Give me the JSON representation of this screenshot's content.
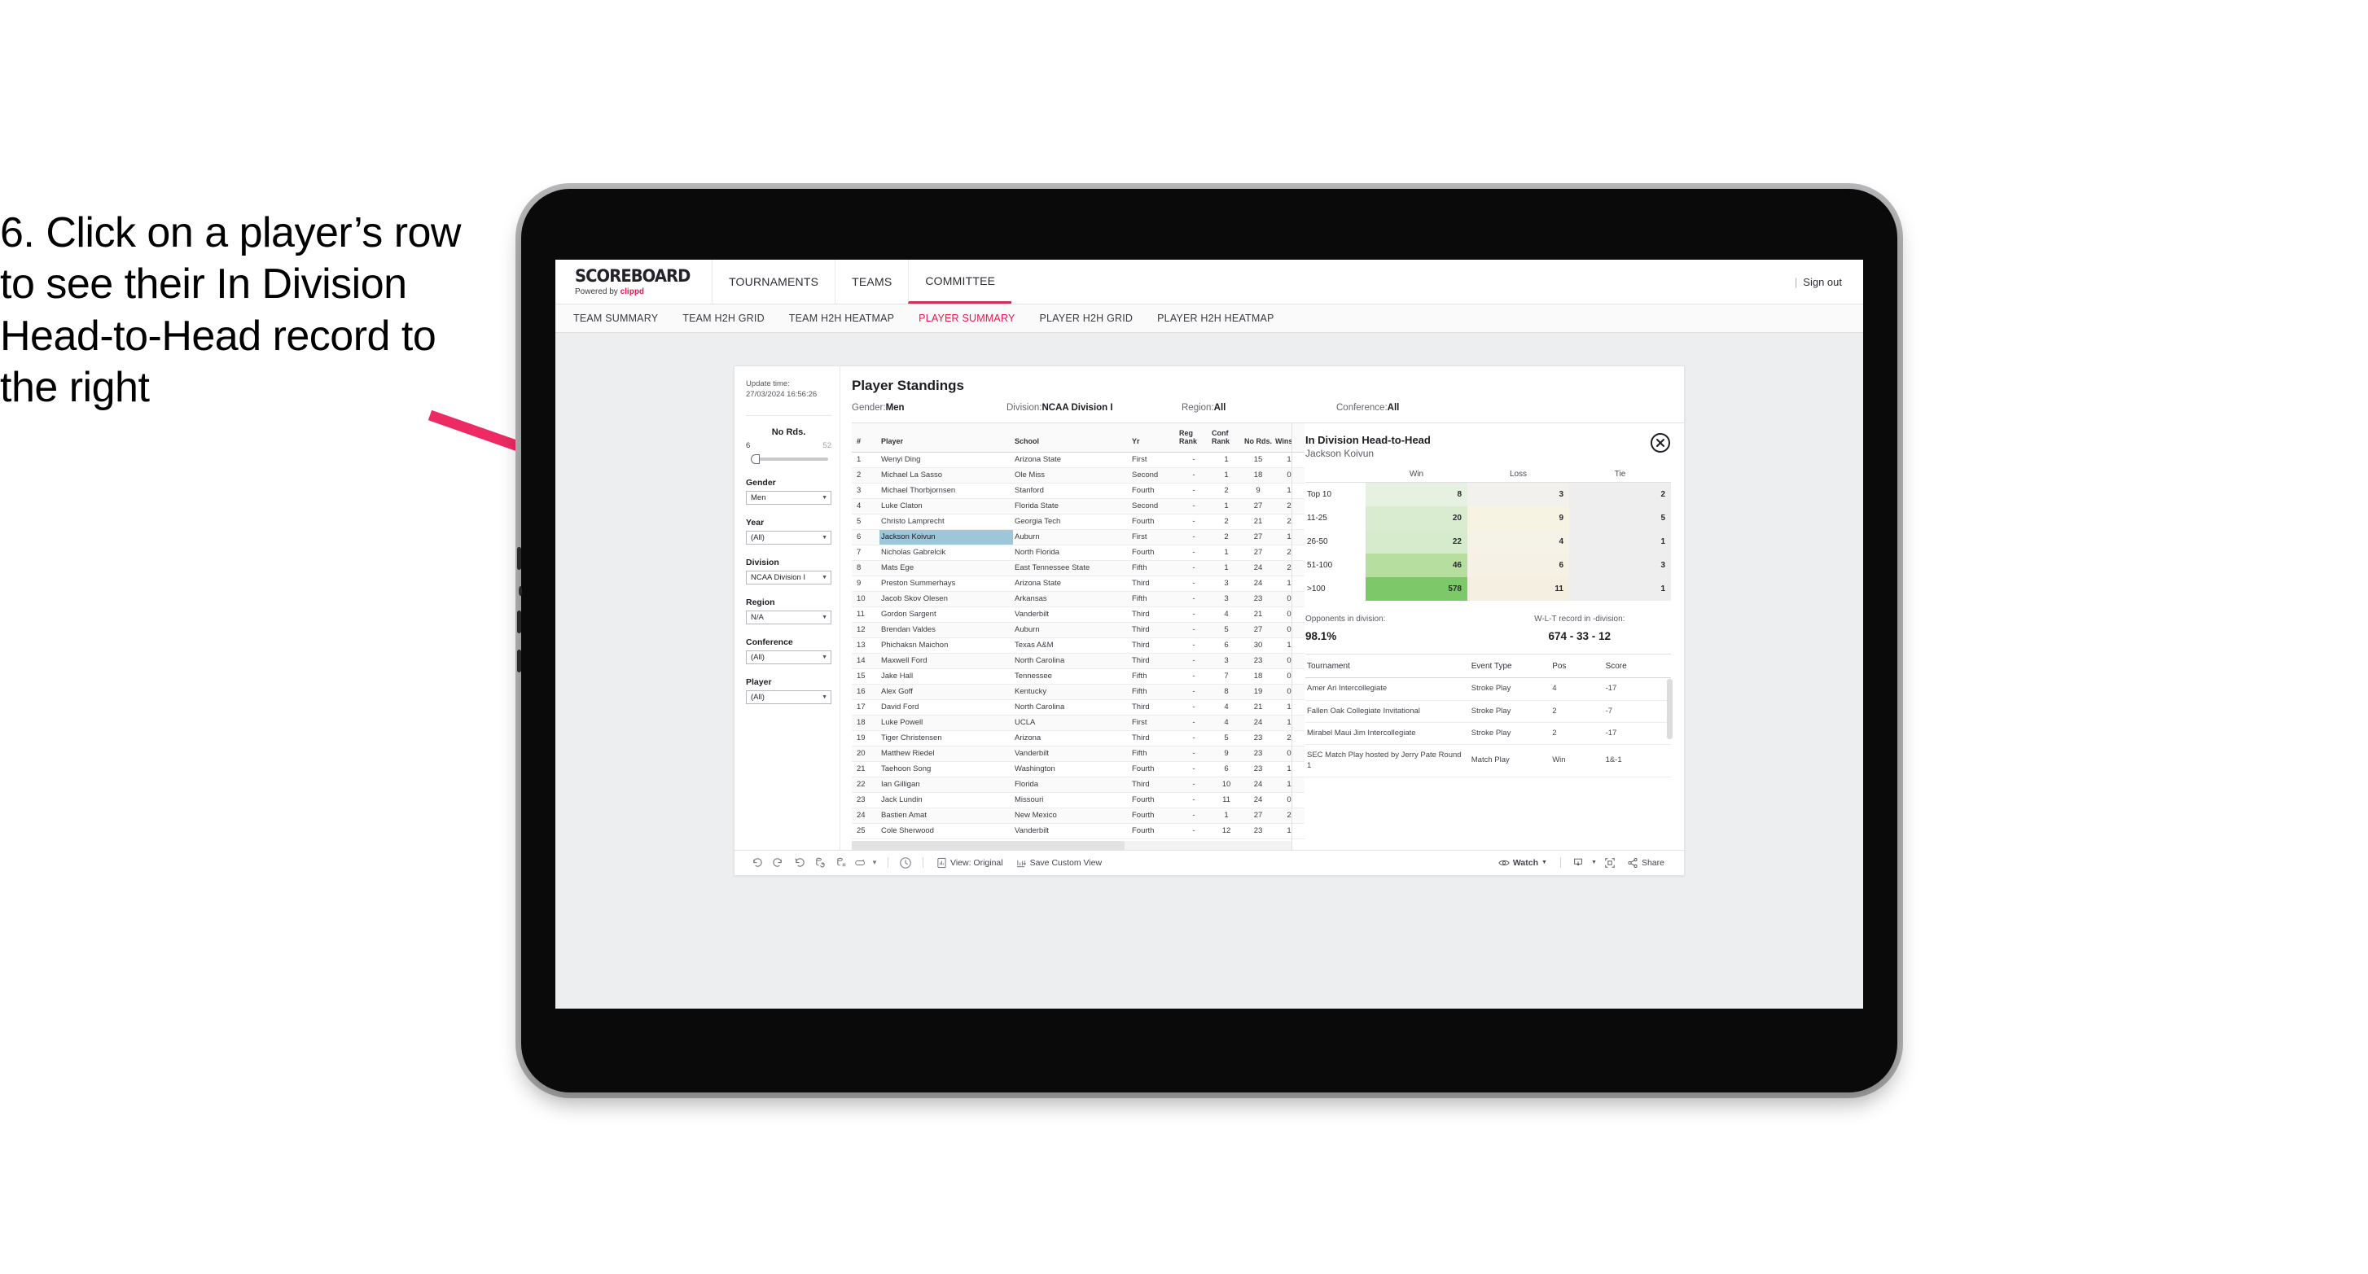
{
  "instruction": "6. Click on a player’s row to see their In Division Head-to-Head record to the right",
  "arrow": {
    "color": "#ed2a63"
  },
  "header": {
    "brand_title": "SCOREBOARD",
    "brand_prefix": "Powered by ",
    "brand_name": "clippd",
    "nav": [
      {
        "label": "TOURNAMENTS",
        "active": false
      },
      {
        "label": "TEAMS",
        "active": false
      },
      {
        "label": "COMMITTEE",
        "active": true
      }
    ],
    "user_separator": "|",
    "sign_out": "Sign out"
  },
  "subnav": [
    {
      "label": "TEAM SUMMARY",
      "active": false
    },
    {
      "label": "TEAM H2H GRID",
      "active": false
    },
    {
      "label": "TEAM H2H HEATMAP",
      "active": false
    },
    {
      "label": "PLAYER SUMMARY",
      "active": true
    },
    {
      "label": "PLAYER H2H GRID",
      "active": false
    },
    {
      "label": "PLAYER H2H HEATMAP",
      "active": false
    }
  ],
  "sidebar": {
    "update_label": "Update time:",
    "update_value": "27/03/2024 16:56:26",
    "slider": {
      "title": "No Rds.",
      "min": "6",
      "max": "52"
    },
    "filters": [
      {
        "label": "Gender",
        "value": "Men"
      },
      {
        "label": "Year",
        "value": "(All)"
      },
      {
        "label": "Division",
        "value": "NCAA Division I"
      },
      {
        "label": "Region",
        "value": "N/A"
      },
      {
        "label": "Conference",
        "value": "(All)"
      },
      {
        "label": "Player",
        "value": "(All)"
      }
    ]
  },
  "standings": {
    "title": "Player Standings",
    "meta": [
      {
        "label": "Gender: ",
        "value": "Men"
      },
      {
        "label": "Division: ",
        "value": "NCAA Division I"
      },
      {
        "label": "Region: ",
        "value": "All"
      },
      {
        "label": "Conference: ",
        "value": "All"
      }
    ],
    "columns": [
      "#",
      "Player",
      "School",
      "Yr",
      "Reg Rank",
      "Conf Rank",
      "No Rds.",
      "Wins"
    ],
    "rows": [
      [
        "1",
        "Wenyi Ding",
        "Arizona State",
        "First",
        "-",
        "1",
        "15",
        "1"
      ],
      [
        "2",
        "Michael La Sasso",
        "Ole Miss",
        "Second",
        "-",
        "1",
        "18",
        "0"
      ],
      [
        "3",
        "Michael Thorbjornsen",
        "Stanford",
        "Fourth",
        "-",
        "2",
        "9",
        "1"
      ],
      [
        "4",
        "Luke Claton",
        "Florida State",
        "Second",
        "-",
        "1",
        "27",
        "2"
      ],
      [
        "5",
        "Christo Lamprecht",
        "Georgia Tech",
        "Fourth",
        "-",
        "2",
        "21",
        "2"
      ],
      [
        "6",
        "Jackson Koivun",
        "Auburn",
        "First",
        "-",
        "2",
        "27",
        "1"
      ],
      [
        "7",
        "Nicholas Gabrelcik",
        "North Florida",
        "Fourth",
        "-",
        "1",
        "27",
        "2"
      ],
      [
        "8",
        "Mats Ege",
        "East Tennessee State",
        "Fifth",
        "-",
        "1",
        "24",
        "2"
      ],
      [
        "9",
        "Preston Summerhays",
        "Arizona State",
        "Third",
        "-",
        "3",
        "24",
        "1"
      ],
      [
        "10",
        "Jacob Skov Olesen",
        "Arkansas",
        "Fifth",
        "-",
        "3",
        "23",
        "0"
      ],
      [
        "11",
        "Gordon Sargent",
        "Vanderbilt",
        "Third",
        "-",
        "4",
        "21",
        "0"
      ],
      [
        "12",
        "Brendan Valdes",
        "Auburn",
        "Third",
        "-",
        "5",
        "27",
        "0"
      ],
      [
        "13",
        "Phichaksn Maichon",
        "Texas A&M",
        "Third",
        "-",
        "6",
        "30",
        "1"
      ],
      [
        "14",
        "Maxwell Ford",
        "North Carolina",
        "Third",
        "-",
        "3",
        "23",
        "0"
      ],
      [
        "15",
        "Jake Hall",
        "Tennessee",
        "Fifth",
        "-",
        "7",
        "18",
        "0"
      ],
      [
        "16",
        "Alex Goff",
        "Kentucky",
        "Fifth",
        "-",
        "8",
        "19",
        "0"
      ],
      [
        "17",
        "David Ford",
        "North Carolina",
        "Third",
        "-",
        "4",
        "21",
        "1"
      ],
      [
        "18",
        "Luke Powell",
        "UCLA",
        "First",
        "-",
        "4",
        "24",
        "1"
      ],
      [
        "19",
        "Tiger Christensen",
        "Arizona",
        "Third",
        "-",
        "5",
        "23",
        "2"
      ],
      [
        "20",
        "Matthew Riedel",
        "Vanderbilt",
        "Fifth",
        "-",
        "9",
        "23",
        "0"
      ],
      [
        "21",
        "Taehoon Song",
        "Washington",
        "Fourth",
        "-",
        "6",
        "23",
        "1"
      ],
      [
        "22",
        "Ian Gilligan",
        "Florida",
        "Third",
        "-",
        "10",
        "24",
        "1"
      ],
      [
        "23",
        "Jack Lundin",
        "Missouri",
        "Fourth",
        "-",
        "11",
        "24",
        "0"
      ],
      [
        "24",
        "Bastien Amat",
        "New Mexico",
        "Fourth",
        "-",
        "1",
        "27",
        "2"
      ],
      [
        "25",
        "Cole Sherwood",
        "Vanderbilt",
        "Fourth",
        "-",
        "12",
        "23",
        "1"
      ]
    ],
    "selected_row_index": 5
  },
  "detail": {
    "title": "In Division Head-to-Head",
    "player": "Jackson Koivun",
    "close_icon": "close-circle-icon",
    "h2h": {
      "columns": [
        "Win",
        "Loss",
        "Tie"
      ],
      "rows": [
        {
          "label": "Top 10",
          "win": "8",
          "loss": "3",
          "tie": "2",
          "win_color": "#e7f1e2",
          "loss_color": "#f2f1ee",
          "tie_color": "#eeeeee"
        },
        {
          "label": "11-25",
          "win": "20",
          "loss": "9",
          "tie": "5",
          "win_color": "#d9ecd0",
          "loss_color": "#f7f3e3",
          "tie_color": "#eeeeee"
        },
        {
          "label": "26-50",
          "win": "22",
          "loss": "4",
          "tie": "1",
          "win_color": "#d5ebcb",
          "loss_color": "#f5f2e8",
          "tie_color": "#eeeeee"
        },
        {
          "label": "51-100",
          "win": "46",
          "loss": "6",
          "tie": "3",
          "win_color": "#b5de9f",
          "loss_color": "#f5f1e4",
          "tie_color": "#eeeeee"
        },
        {
          "label": ">100",
          "win": "578",
          "loss": "11",
          "tie": "1",
          "win_color": "#7dc96a",
          "loss_color": "#f4efe0",
          "tie_color": "#eeeeee"
        }
      ]
    },
    "stats": [
      {
        "label": "Opponents in division:",
        "value": "98.1%"
      },
      {
        "label": "W-L-T record in -division:",
        "value": "674 - 33 - 12"
      }
    ],
    "tournaments": {
      "columns": [
        "Tournament",
        "Event Type",
        "Pos",
        "Score"
      ],
      "rows": [
        [
          "Amer Ari Intercollegiate",
          "Stroke Play",
          "4",
          "-17"
        ],
        [
          "Fallen Oak Collegiate Invitational",
          "Stroke Play",
          "2",
          "-7"
        ],
        [
          "Mirabel Maui Jim Intercollegiate",
          "Stroke Play",
          "2",
          "-17"
        ],
        [
          "SEC Match Play hosted by Jerry Pate Round 1",
          "Match Play",
          "Win",
          "1&-1"
        ]
      ]
    }
  },
  "toolbar": {
    "icons_left": [
      "undo-icon",
      "redo-icon",
      "revert-icon",
      "refresh-data-icon",
      "pause-auto-update-icon",
      "alerts-icon",
      "chevron-down-icon"
    ],
    "clock_icon": "clock-history-icon",
    "view_label": "View: Original",
    "view_icon": "view-original-icon",
    "save_label": "Save Custom View",
    "save_icon": "save-view-icon",
    "watch_label": "Watch",
    "watch_icon": "eye-icon",
    "download_icon": "download-icon",
    "fullscreen_icon": "fullscreen-icon",
    "share_label": "Share",
    "share_icon": "share-icon"
  }
}
